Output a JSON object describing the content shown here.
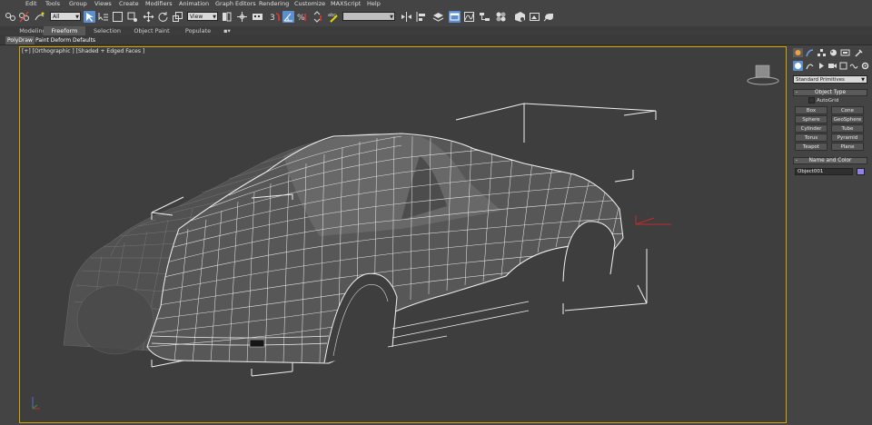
{
  "menu": [
    "Edit",
    "Tools",
    "Group",
    "Views",
    "Create",
    "Modifiers",
    "Animation",
    "Graph Editors",
    "Rendering",
    "Customize",
    "MAXScript",
    "Help"
  ],
  "toolbar": {
    "selection_filter": "All",
    "reference_coord": "View",
    "named_selection_placeholder": ""
  },
  "ribbon": {
    "tabs": [
      "Modeling",
      "Freeform",
      "Selection",
      "Object Paint",
      "Populate"
    ],
    "active_tab": "Freeform",
    "subtabs": [
      "PolyDraw",
      "Paint Deform",
      "Defaults"
    ]
  },
  "viewport": {
    "label": "[+] [Orthographic ] [Shaded + Edged Faces ]"
  },
  "command_panel": {
    "category": "Standard Primitives",
    "object_type": {
      "title": "Object Type",
      "autogrid": "AutoGrid",
      "buttons": [
        "Box",
        "Cone",
        "Sphere",
        "GeoSphere",
        "Cylinder",
        "Tube",
        "Torus",
        "Pyramid",
        "Teapot",
        "Plane"
      ]
    },
    "name_and_color": {
      "title": "Name and Color",
      "name": "Object001",
      "color": "#8f83e6"
    }
  },
  "colors": {
    "viewport_border": "#d4a500",
    "viewport_bg": "#3e3e3e",
    "wire": "#ececec",
    "accent": "#5b8fcf"
  }
}
